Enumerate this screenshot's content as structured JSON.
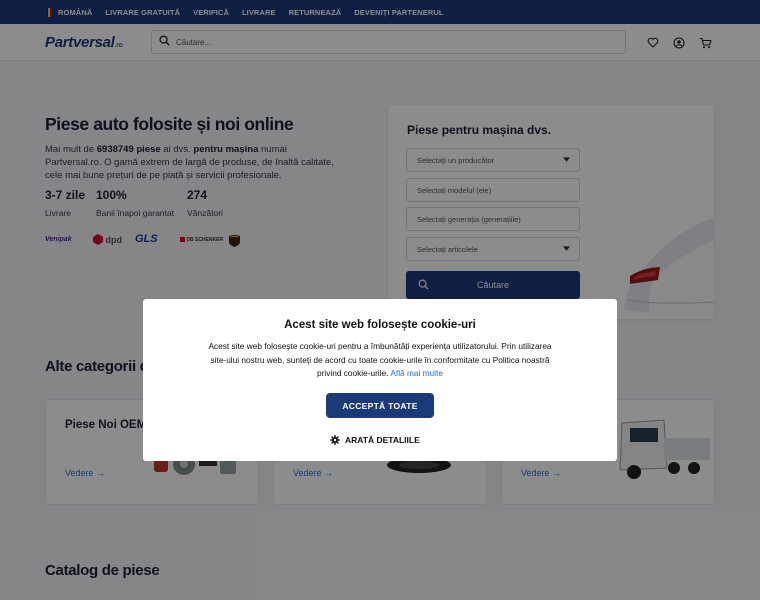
{
  "topbar": {
    "language": "ROMÂNĂ",
    "links": [
      "LIVRARE GRATUITĂ",
      "VERIFICĂ",
      "LIVRARE",
      "RETURNEAZĂ",
      "DEVENIȚI PARTENERUL"
    ],
    "flag_colors": [
      "#002b7f",
      "#fcd116",
      "#ce1126"
    ]
  },
  "header": {
    "logo_text": "Partversal",
    "logo_suffix": ".ro",
    "search_placeholder": "Căutare...",
    "icons": [
      "search-icon",
      "heart-icon",
      "user-icon",
      "cart-icon"
    ]
  },
  "hero": {
    "title": "Piese auto folosite și noi online",
    "text_pre": "Mai mult de ",
    "count": "6938749 piese",
    "text_mid": " ai dvs. ",
    "bold2": "pentru mașina",
    "text_post": " numai Partversal.ro. O gamă extrem de largă de produse, de înaltă calitate, cele mai bune prețuri de pe piață și servicii profesionale.",
    "stats": [
      {
        "value": "3-7 zile",
        "label": "Livrare"
      },
      {
        "value": "100%",
        "label": "Banii înapoi garantat"
      },
      {
        "value": "274",
        "label": "Vânzători"
      }
    ],
    "couriers": [
      "Venipak",
      "dpd",
      "GLS",
      "DB SCHENKER",
      "UPS"
    ]
  },
  "car_search": {
    "title": "Piese pentru mașina dvs.",
    "fields": [
      "Selectați un producător",
      "Selectați modelul (ele)",
      "Selectați generația (generațiile)",
      "Selectați articolele"
    ],
    "button": "Căutare"
  },
  "sections": {
    "categories_title": "Alte categorii de",
    "cards": [
      {
        "title": "Piese Noi OEM",
        "link": "Vedere →"
      },
      {
        "title": "",
        "link": "Vedere →"
      },
      {
        "title": "",
        "link": "Vedere →"
      }
    ],
    "catalog_title": "Catalog de piese"
  },
  "cookie_modal": {
    "title": "Acest site web folosește cookie-uri",
    "body": "Acest site web folosește cookie-uri pentru a îmbunătăți experiența utilizatorului. Prin utilizarea site-ului nostru web, sunteți de acord cu toate cookie-urile în conformitate cu Politica noastră privind cookie-urile.",
    "more_link": "Află mai multe",
    "accept": "ACCEPTĂ TOATE",
    "details": "ARATĂ DETALIILE"
  },
  "colors": {
    "brand": "#1b3a78",
    "link": "#2a6fd6"
  }
}
